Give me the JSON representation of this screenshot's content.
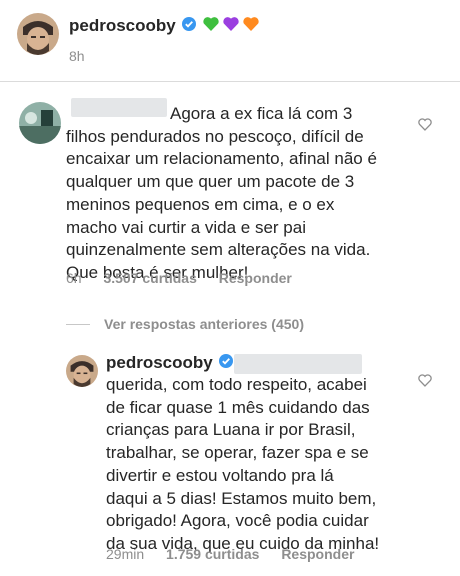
{
  "caption": {
    "username": "pedroscooby",
    "time": "8h",
    "hearts": [
      "#3fbf3f",
      "#9b3fe0",
      "#ff8a1f"
    ]
  },
  "comment1": {
    "text_lines": [
      "Agora a ex fica lá com 3",
      "filhos pendurados no pescoço, difícil de",
      "encaixar um relacionamento, afinal não é",
      "qualquer um que quer um pacote de 3",
      "meninos pequenos em cima, e o ex",
      "macho vai curtir a vida e ser pai",
      "quinzenalmente sem alterações na vida.",
      "Que bosta é ser mulher!"
    ],
    "time": "6h",
    "likes": "3.507 curtidas",
    "reply_label": "Responder"
  },
  "replies": {
    "view_label": "Ver respostas anteriores (450)"
  },
  "reply1": {
    "username": "pedroscooby",
    "text_lines": [
      "querida, com todo respeito, acabei",
      "de ficar quase 1 mês cuidando das",
      "crianças para Luana ir por Brasil,",
      "trabalhar, se operar, fazer spa e se",
      "divertir e estou voltando pra lá",
      "daqui a 5 dias! Estamos muito bem,",
      "obrigado! Agora, você podia cuidar",
      "da sua vida, que eu cuido da minha!"
    ],
    "time": "29min",
    "likes": "1.759 curtidas",
    "reply_label": "Responder"
  },
  "colors": {
    "verified": "#3897f0",
    "divider": "#dbdbdb",
    "meta": "#8e8e8e"
  }
}
